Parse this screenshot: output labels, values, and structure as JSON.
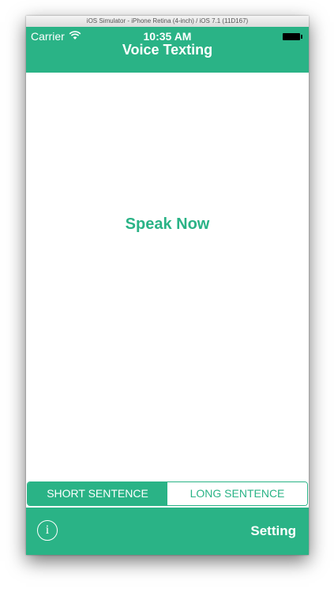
{
  "window": {
    "title": "iOS Simulator - iPhone Retina (4-inch) / iOS 7.1 (11D167)"
  },
  "status_bar": {
    "carrier": "Carrier",
    "time": "10:35 AM"
  },
  "nav": {
    "title": "Voice Texting"
  },
  "main": {
    "prompt": "Speak Now"
  },
  "segments": {
    "short_label": "SHORT SENTENCE",
    "long_label": "LONG SENTENCE",
    "selected": "SHORT SENTENCE"
  },
  "bottom_bar": {
    "info_glyph": "i",
    "setting_label": "Setting"
  },
  "colors": {
    "accent": "#2ab386",
    "text_on_accent": "#ffffff"
  },
  "icons": {
    "wifi": "wifi-icon",
    "battery": "battery-icon",
    "info": "info-icon"
  }
}
